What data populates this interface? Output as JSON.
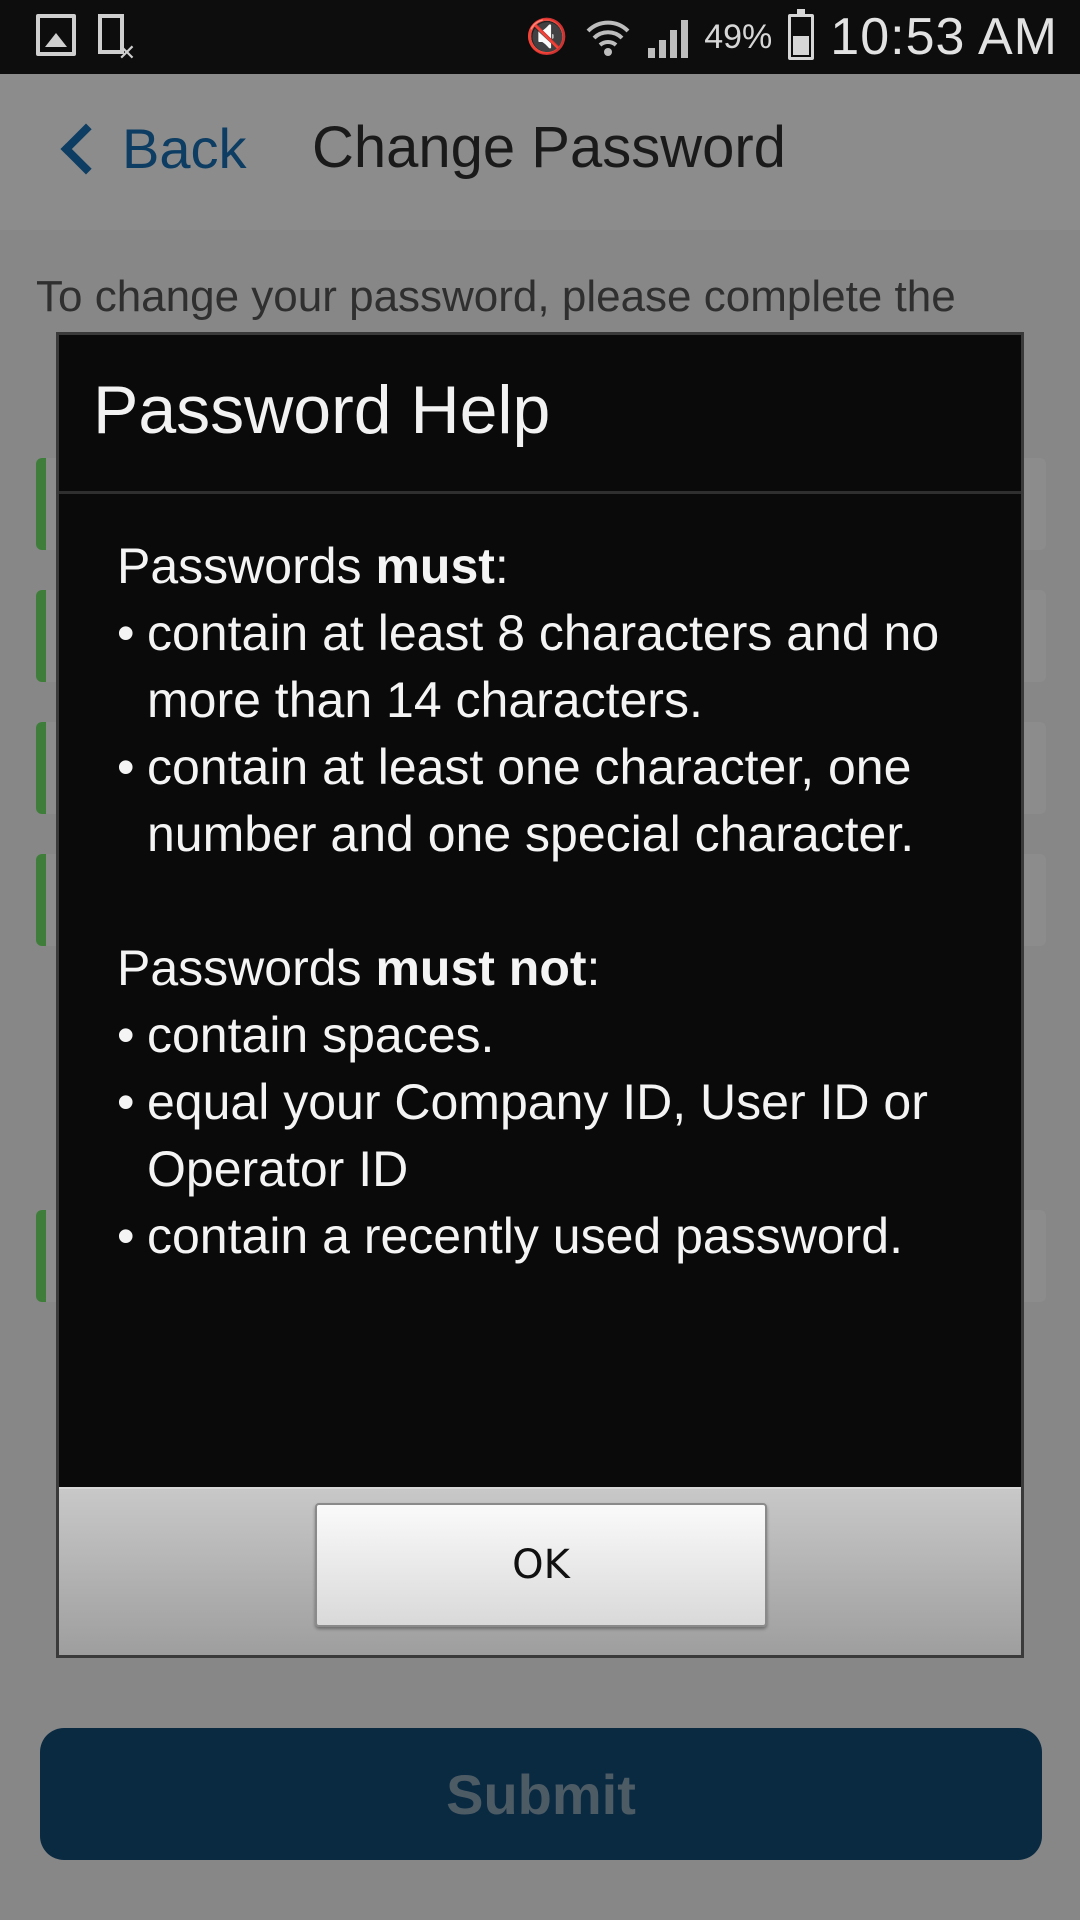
{
  "status_bar": {
    "battery": "49%",
    "time": "10:53 AM"
  },
  "nav": {
    "back_label": "Back",
    "title": "Change Password"
  },
  "background": {
    "intro_text": "To change your password, please complete the",
    "submit_label": "Submit"
  },
  "dialog": {
    "title": "Password Help",
    "must_prefix": "Passwords ",
    "must_bold": "must",
    "must_rules": [
      "contain at least 8 characters and no more than 14 characters.",
      "contain at least one character, one number and one special character."
    ],
    "must_not_prefix": "Passwords ",
    "must_not_bold": "must not",
    "must_not_rules": [
      "contain spaces.",
      "equal your Company ID, User ID or Operator ID",
      "contain a recently used password."
    ],
    "ok_label": "OK"
  }
}
